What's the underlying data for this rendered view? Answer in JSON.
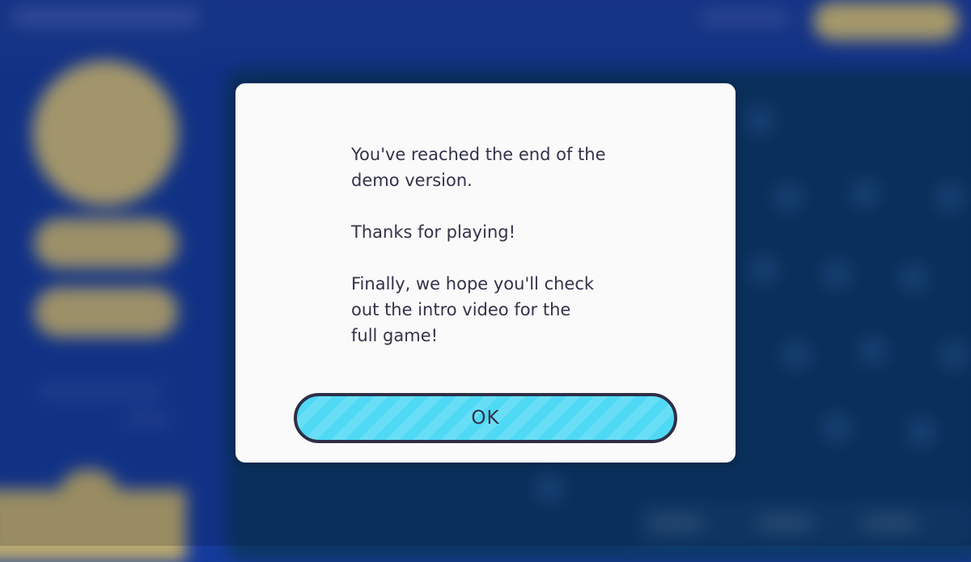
{
  "colors": {
    "background": "#143a9c",
    "panel": "#0d3766",
    "gold": "#c6b47b",
    "dialog": "#fafafa",
    "dialog_text": "#33334a",
    "button_fill": "#4fd9f5",
    "button_border": "#2e2f46"
  },
  "dialog": {
    "paragraphs": [
      "You've reached the end of the\ndemo version.",
      "Thanks for playing!",
      "Finally, we hope you'll check\nout the intro video for the\nfull game!"
    ],
    "ok_label": "OK"
  }
}
